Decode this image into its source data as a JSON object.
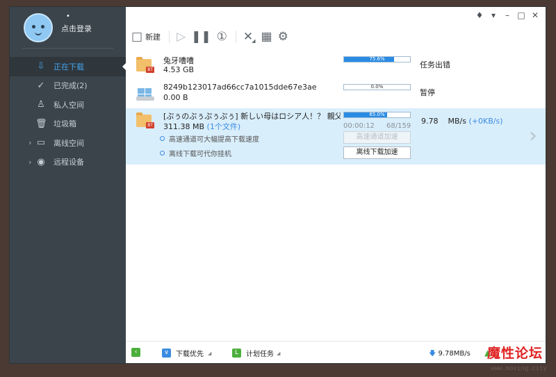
{
  "user": {
    "dot": "•",
    "login": "点击登录"
  },
  "sidebar": {
    "items": [
      {
        "label": "正在下载",
        "icon": "⇩"
      },
      {
        "label": "已完成(2)",
        "icon": "✓"
      },
      {
        "label": "私人空间",
        "icon": "♙"
      },
      {
        "label": "垃圾箱",
        "icon": "🗑"
      },
      {
        "label": "离线空间",
        "icon": "▭",
        "caret": "›"
      },
      {
        "label": "远程设备",
        "icon": "◉",
        "caret": "›"
      }
    ]
  },
  "toolbar": {
    "new_label": "新建"
  },
  "tasks": [
    {
      "name": "兔牙嘈嘈",
      "size": "4.53 GB",
      "progress": "75.6%",
      "progress_value": 75.6,
      "status": "任务出错"
    },
    {
      "name": "8249b123017ad66cc7a1015dde67e3ae",
      "size": "0.00 B",
      "progress": "0.0%",
      "progress_value": 0.0,
      "status": "暂停"
    },
    {
      "name": "[ぷぅのぷぅぷぅぷぅ] 新しい母はロシア人！？ 親父にな...",
      "size": "311.38 MB",
      "file_count": "(1个文件)",
      "progress": "65.0%",
      "progress_value": 65.0,
      "elapsed": "00:00:12",
      "pieces": "68/159",
      "speed": "9.78",
      "speed_unit": "MB/s",
      "up_speed": "(+0KB/s)",
      "tip1": "高速通道可大幅提高下载速度",
      "tip2": "离线下载可代你挂机",
      "btn_high_speed": "高速通道加速",
      "btn_offline": "离线下载加速"
    }
  ],
  "footer": {
    "priority": "下载优先",
    "plan": "计划任务",
    "speed": "9.78MB/s"
  },
  "watermark": {
    "text": "魔性论坛",
    "url": "www.moxing.city"
  }
}
